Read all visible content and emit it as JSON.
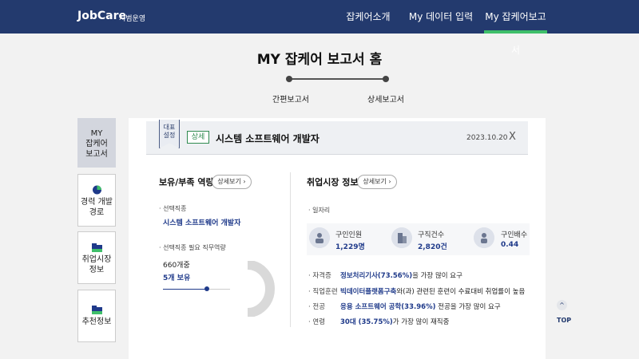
{
  "header": {
    "logo": "JobCare",
    "logo_sub": "시범운영",
    "nav": [
      "잡케어소개",
      "My 데이터 입력",
      "My 잡케어보고서"
    ],
    "active_nav": 2,
    "accent": "#3fbf6a",
    "bg": "#233a6e"
  },
  "page_title": "MY 잡케어 보고서 홈",
  "steps": [
    "간편보고서",
    "상세보고서"
  ],
  "left_tabs": [
    {
      "label": "MY\n잡케어\n보고서",
      "icon": ""
    },
    {
      "label": "경력 개발\n경로",
      "icon": "pie-chart-icon"
    },
    {
      "label": "취업시장\n정보",
      "icon": "folder-icon"
    },
    {
      "label": "추천정보",
      "icon": "folder-icon"
    }
  ],
  "card": {
    "flag": "대표\n설정",
    "tag": "상세",
    "title": "시스템 소프트웨어 개발자",
    "date": "2023.10.20",
    "close": "X"
  },
  "skills": {
    "title": "보유/부족 역량",
    "detail": "상세보기",
    "job_label": "· 선택직종",
    "job_value": "시스템 소프트웨어 개발자",
    "req_label": "· 선택직종 필요 직무역량",
    "total": "660개중",
    "owned": "5개 보유"
  },
  "market": {
    "title": "취업시장 정보",
    "detail": "상세보기",
    "jobs_label": "· 일자리",
    "stats": [
      {
        "label": "구인인원",
        "value": "1,229명",
        "icon": "people-icon"
      },
      {
        "label": "구직건수",
        "value": "2,820건",
        "icon": "building-icon"
      },
      {
        "label": "구인배수",
        "value": "0.44",
        "icon": "person-icon"
      }
    ],
    "rows": [
      {
        "key": "· 자격증",
        "hl": "정보처리기사(73.56%)",
        "rest": "을 가장 많이 요구"
      },
      {
        "key": "· 직업훈련",
        "hl": "빅데이터플랫폼구축",
        "rest": "와(과) 관련된 훈련이 수료대비 취업률이 높음"
      },
      {
        "key": "· 전공",
        "hl": "응용 소프트웨어 공학(33.96%)",
        "rest": " 전공을 가장 많이 요구"
      },
      {
        "key": "· 연령",
        "hl": "30대 (35.75%)",
        "rest": "가 가장 많이 재직중"
      }
    ]
  },
  "top": {
    "arrow": "^",
    "label": "TOP"
  }
}
